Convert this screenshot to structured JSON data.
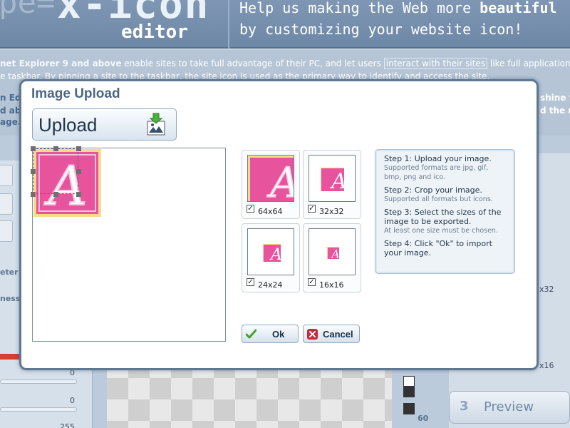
{
  "header": {
    "logo_prefix": "pe=",
    "logo_main": "x-icon",
    "logo_sub": "editor",
    "tagline_line1_prefix": "Help us making the Web more ",
    "tagline_line1_bold": "beautiful",
    "tagline_line2": "by customizing your website icon!"
  },
  "intro": {
    "line1_bold": "net Explorer 9 and above",
    "line1_mid": " enable sites to take full advantage of their PC, and let users ",
    "line1_highlight": "interact with their sites",
    "line1_end": " like full application",
    "line2": "e taskbar. By pinning a site to the taskbar, the site icon is used as the primary way to identify and access the site.",
    "line3_left": "n Ed",
    "line3_right": "shine w",
    "line4_left": "d ab",
    "line4_right": "d the m",
    "line5_left": "age."
  },
  "background": {
    "label_meter": "eter",
    "label_ness": "ness",
    "value_a": "0",
    "value_b": "0",
    "value_c": "255",
    "value_60": "60",
    "label_32": "x32",
    "label_16": "x16",
    "preview_step_number": "3",
    "preview_label": "Preview"
  },
  "modal": {
    "title": "Image Upload",
    "upload_label": "Upload",
    "thumbnails": [
      {
        "label": "64x64",
        "checked": true
      },
      {
        "label": "32x32",
        "checked": true
      },
      {
        "label": "24x24",
        "checked": true
      },
      {
        "label": "16x16",
        "checked": true
      }
    ],
    "steps": [
      {
        "heading": "Step 1: Upload your image.",
        "note": "Supported formats are jpg, gif, bmp, png and ico."
      },
      {
        "heading": "Step 2: Crop your image.",
        "note": "Supported all formats but icons."
      },
      {
        "heading": "Step 3: Select the sizes of the image to be exported.",
        "note": "At least one size must be chosen."
      },
      {
        "heading": "Step 4: Click \"Ok\" to import your image.",
        "note": ""
      }
    ],
    "ok_label": "Ok",
    "cancel_label": "Cancel"
  },
  "colors": {
    "icon_pink": "#e8539e",
    "icon_border": "#f5e26a",
    "ok_check": "#3fa32b",
    "cancel_x": "#c8283a"
  }
}
